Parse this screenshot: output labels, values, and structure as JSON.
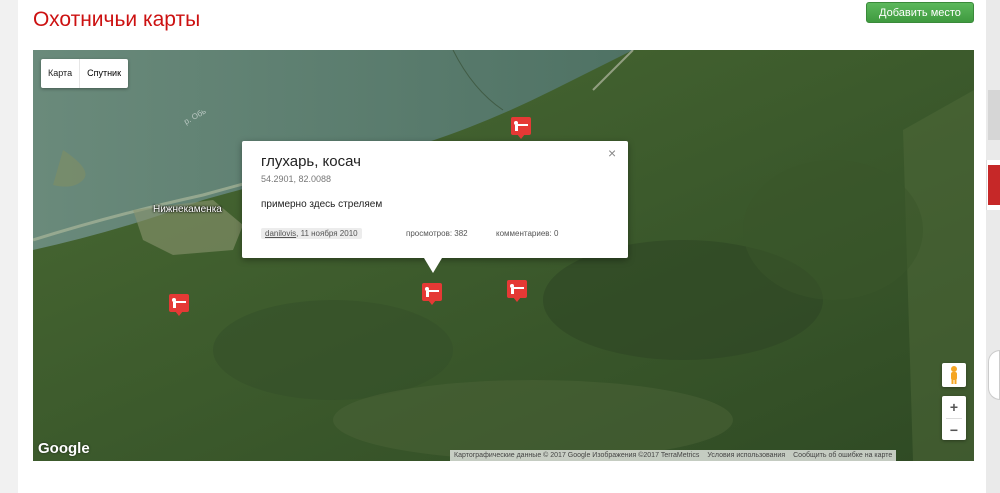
{
  "header": {
    "title": "Охотничьи карты",
    "add_button_label": "Добавить место"
  },
  "map": {
    "type_control": {
      "map_label": "Карта",
      "satellite_label": "Спутник",
      "selected": "Спутник"
    },
    "labels": {
      "village": "Нижнекаменка",
      "river": "р. Обь"
    },
    "markers": [
      {
        "name": "hunting-marker",
        "icon": "hunter-rifle-icon"
      },
      {
        "name": "hunting-marker",
        "icon": "hunter-rifle-icon"
      },
      {
        "name": "hunting-marker",
        "icon": "hunter-rifle-icon"
      },
      {
        "name": "hunting-marker",
        "icon": "hunter-rifle-icon"
      }
    ],
    "marker_color": "#e53935",
    "info_window": {
      "title": "глухарь, косач",
      "coords": "54.2901, 82.0088",
      "description": "примерно здесь стреляем",
      "author": "danilovis",
      "date": ", 11 ноября 2010",
      "views": "просмотров: 382",
      "comments": "комментариев: 0",
      "close_icon": "×"
    },
    "zoom_in": "+",
    "zoom_out": "−",
    "google_logo": "Google",
    "attribution": {
      "data": "Картографические данные © 2017 Google Изображения ©2017 TerraMetrics",
      "terms": "Условия использования",
      "report": "Сообщить об ошибке на карте"
    }
  },
  "colors": {
    "title": "#cc1111",
    "button": "#4cae4c",
    "water": "#5a7d6e",
    "forest": "#3f5a2e"
  }
}
